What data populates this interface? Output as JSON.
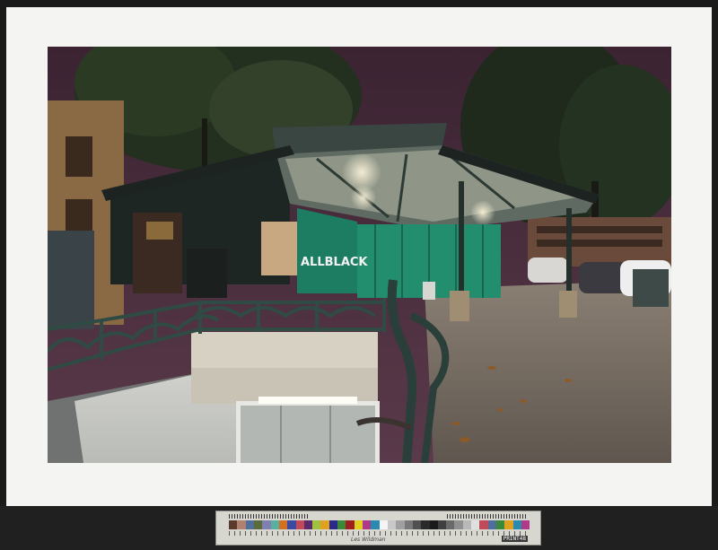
{
  "photo": {
    "subject": "metro-entrance-night",
    "graffiti_text": "ALLBLACK",
    "colors": {
      "sky": "#4a2e3e",
      "canopy_frame": "#2d3a33",
      "green_hoarding": "#1f8a6a",
      "pavement": "#6f665c",
      "railing": "#2f4b44",
      "stairwell_wall": "#d9dad6"
    }
  },
  "color_target": {
    "label": "Les Wildman",
    "code": "PRINT48",
    "patch_colors": [
      "#5a3a2a",
      "#b08070",
      "#4f6f9a",
      "#5b6b3a",
      "#7f80b0",
      "#59b0a0",
      "#d07020",
      "#3a4aa0",
      "#c04a5a",
      "#5a2a6a",
      "#a0c040",
      "#e0a020",
      "#2a2a8a",
      "#3a8a3a",
      "#a02020",
      "#e0d020",
      "#b03a8a",
      "#2a8ab0",
      "#f4f4f4",
      "#c8c8c8",
      "#a0a0a0",
      "#787878",
      "#505050",
      "#2a2a2a",
      "#1a1a1a",
      "#404040",
      "#6a6a6a",
      "#909090",
      "#b8b8b8",
      "#e0e0e0",
      "#c04a5a",
      "#4f6f9a",
      "#3a8a3a",
      "#e0a020",
      "#2a8ab0",
      "#b03a8a"
    ]
  }
}
